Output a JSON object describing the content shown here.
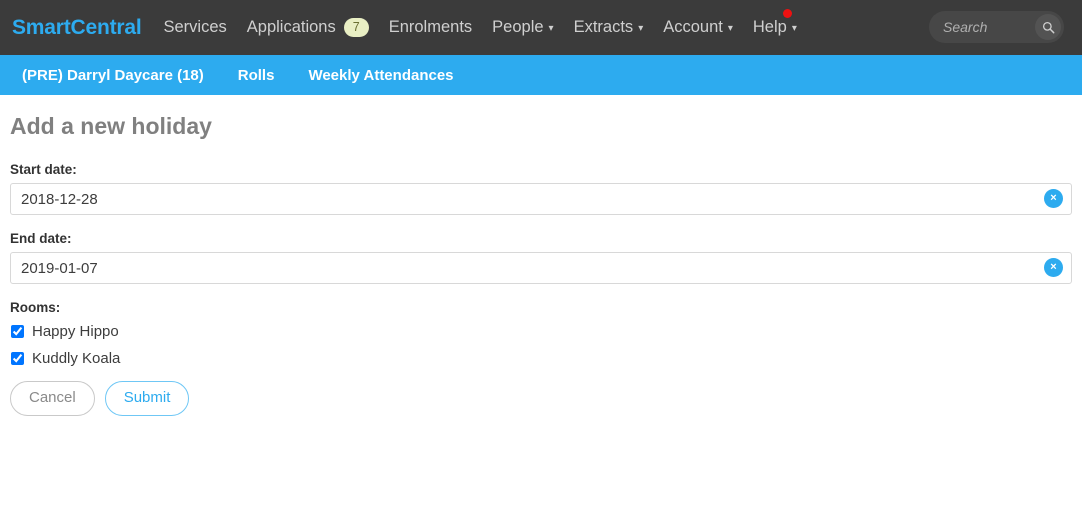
{
  "topnav": {
    "brand": "SmartCentral",
    "items": [
      {
        "label": "Services",
        "caret": "",
        "badge": ""
      },
      {
        "label": "Applications",
        "caret": "",
        "badge": "7"
      },
      {
        "label": "Enrolments",
        "caret": "",
        "badge": ""
      },
      {
        "label": "People",
        "caret": "▾",
        "badge": ""
      },
      {
        "label": "Extracts",
        "caret": "▾",
        "badge": ""
      },
      {
        "label": "Account",
        "caret": "▾",
        "badge": ""
      },
      {
        "label": "Help",
        "caret": "▾",
        "badge": ""
      }
    ],
    "search": {
      "placeholder": "Search",
      "value": "",
      "icon": "search-icon"
    },
    "notification_dot": true,
    "background_color": "#3b3b3b",
    "brand_color": "#2dabef"
  },
  "subnav": {
    "background_color": "#2dabef",
    "items": [
      {
        "label": "(PRE) Darryl Daycare (18)"
      },
      {
        "label": "Rolls"
      },
      {
        "label": "Weekly Attendances"
      }
    ]
  },
  "main": {
    "title": "Add a new holiday",
    "start_date": {
      "label": "Start date:",
      "value": "2018-12-28",
      "placeholder": "",
      "clear_icon": "×"
    },
    "end_date": {
      "label": "End date:",
      "value": "2019-01-07",
      "placeholder": "",
      "clear_icon": "×"
    },
    "rooms": {
      "label": "Rooms:",
      "options": [
        {
          "label": "Happy Hippo",
          "checked": true
        },
        {
          "label": "Kuddly Koala",
          "checked": true
        }
      ]
    },
    "buttons": {
      "cancel": "Cancel",
      "submit": "Submit"
    }
  }
}
